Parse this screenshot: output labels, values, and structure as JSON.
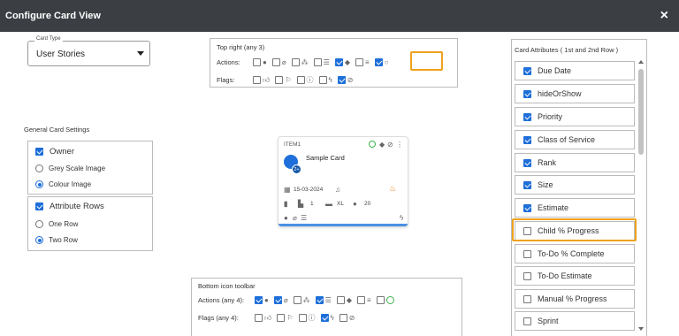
{
  "dialog": {
    "title": "Configure Card View",
    "close_symbol": "×"
  },
  "card_type": {
    "label": "Card Type",
    "value": "User Stories"
  },
  "general": {
    "title": "General Card Settings",
    "owner": {
      "label": "Owner",
      "checked": true
    },
    "grey_scale": {
      "label": "Grey Scale Image",
      "selected": false
    },
    "colour": {
      "label": "Colour Image",
      "selected": true
    },
    "attribute_rows": {
      "label": "Attribute Rows",
      "checked": true
    },
    "one_row": {
      "label": "One Row",
      "selected": false
    },
    "two_row": {
      "label": "Two Row",
      "selected": true
    }
  },
  "top_right": {
    "title": "Top right (any 3)",
    "actions_label": "Actions:",
    "flags_label": "Flags:",
    "actions": [
      {
        "icon": "comment-icon",
        "checked": false
      },
      {
        "icon": "attachment-icon",
        "checked": false
      },
      {
        "icon": "hierarchy-icon",
        "checked": false
      },
      {
        "icon": "checklist-icon",
        "checked": false
      },
      {
        "icon": "tag-icon",
        "checked": true
      },
      {
        "icon": "list-icon",
        "checked": false
      },
      {
        "icon": "progress-circle-icon",
        "checked": true
      }
    ],
    "flags": [
      {
        "icon": "thumbs-up-icon",
        "checked": false
      },
      {
        "icon": "flag-icon",
        "checked": false
      },
      {
        "icon": "alert-icon",
        "checked": false
      },
      {
        "icon": "lightning-icon",
        "checked": false
      },
      {
        "icon": "blocked-icon",
        "checked": true
      }
    ]
  },
  "sample_card": {
    "item_id": "ITEM1",
    "title": "Sample Card",
    "avatar_badge": "2+",
    "date": "15-03-2024",
    "rank": "1",
    "size": "XL",
    "estimate": "20"
  },
  "bottom_toolbar": {
    "title": "Bottom icon toolbar",
    "actions_label": "Actions (any 4):",
    "flags_label": "Flags (any 4):",
    "actions": [
      {
        "icon": "comment-icon",
        "checked": true
      },
      {
        "icon": "attachment-icon",
        "checked": true
      },
      {
        "icon": "hierarchy-icon",
        "checked": false
      },
      {
        "icon": "checklist-icon",
        "checked": true
      },
      {
        "icon": "tag-icon",
        "checked": false
      },
      {
        "icon": "list-icon",
        "checked": false
      },
      {
        "icon": "progress-circle-icon",
        "checked": false
      }
    ],
    "flags": [
      {
        "icon": "thumbs-up-icon",
        "checked": false
      },
      {
        "icon": "flag-icon",
        "checked": false
      },
      {
        "icon": "alert-icon",
        "checked": false
      },
      {
        "icon": "lightning-icon",
        "checked": true
      },
      {
        "icon": "blocked-icon",
        "checked": false
      }
    ]
  },
  "attributes": {
    "title": "Card Attributes ( 1st and 2nd Row )",
    "items": [
      {
        "label": "Due Date",
        "checked": true
      },
      {
        "label": "hideOrShow",
        "checked": true
      },
      {
        "label": "Priority",
        "checked": true
      },
      {
        "label": "Class of Service",
        "checked": true
      },
      {
        "label": "Rank",
        "checked": true
      },
      {
        "label": "Size",
        "checked": true
      },
      {
        "label": "Estimate",
        "checked": true
      },
      {
        "label": "Child % Progress",
        "checked": false
      },
      {
        "label": "To-Do % Complete",
        "checked": false
      },
      {
        "label": "To-Do Estimate",
        "checked": false
      },
      {
        "label": "Manual % Progress",
        "checked": false
      },
      {
        "label": "Sprint",
        "checked": false
      }
    ]
  },
  "colors": {
    "accent": "#1e6fd9",
    "highlight": "#f0a21e",
    "titlebar": "#3b3f44",
    "progress_green": "#3cb44b"
  }
}
